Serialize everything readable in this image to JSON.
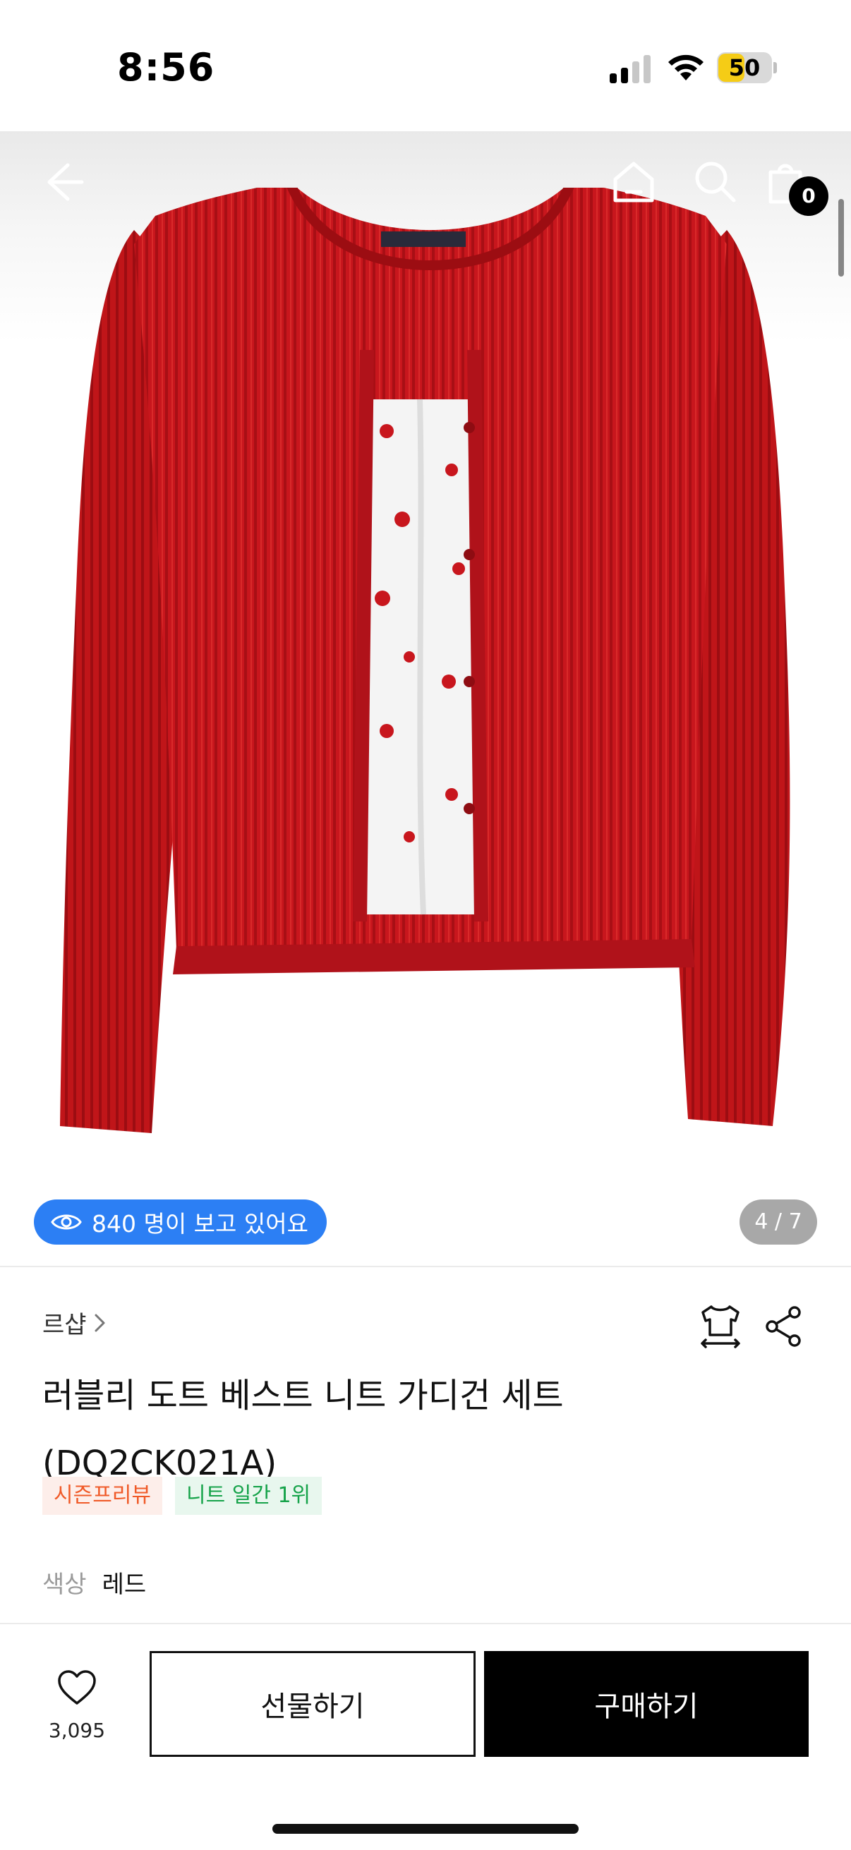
{
  "status_bar": {
    "time": "8:56",
    "battery_level": "50",
    "battery_color": "#f5cc16",
    "signal_icon": "cellular-signal-icon",
    "wifi_icon": "wifi-icon"
  },
  "nav": {
    "back_icon": "arrow-left-icon",
    "home_icon": "home-icon",
    "search_icon": "search-icon",
    "bag_icon": "shopping-bag-icon",
    "bag_count": "0"
  },
  "gallery": {
    "viewers_text": "840 명이 보고 있어요",
    "viewers_pill_color": "#2c7ff4",
    "page_indicator": "4 / 7",
    "current_image": 4,
    "total_images": 7,
    "image_description_icon": "product-image-cardigan"
  },
  "product": {
    "brand": "르샵",
    "title": "러블리 도트 베스트 니트 가디건 세트 (DQ2CK021A)",
    "tags": [
      {
        "label": "시즌프리뷰",
        "color": "#f05a28",
        "background": "#fdeeea"
      },
      {
        "label": "니트 일간 1위",
        "color": "#16a34a",
        "background": "#e8f7ee"
      }
    ],
    "color_label": "색상",
    "color_value": "레드"
  },
  "bottom_bar": {
    "like_count": "3,095",
    "gift_label": "선물하기",
    "buy_label": "구매하기"
  }
}
